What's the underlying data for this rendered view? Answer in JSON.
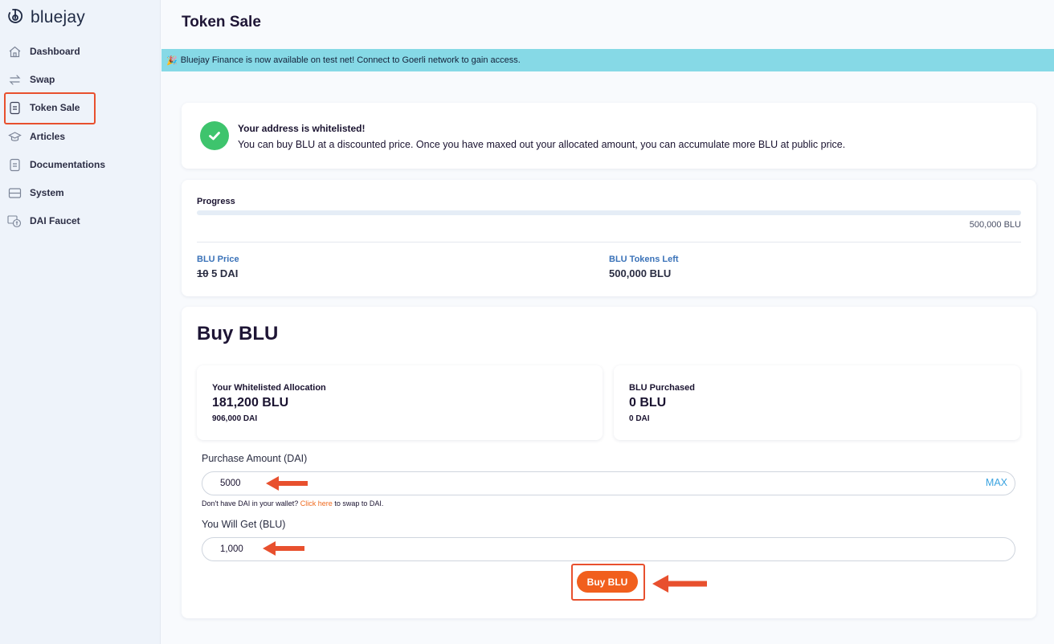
{
  "app": {
    "brand": "bluejay"
  },
  "sidebar": {
    "items": [
      {
        "label": "Dashboard",
        "icon": "home-icon"
      },
      {
        "label": "Swap",
        "icon": "swap-arrows-icon"
      },
      {
        "label": "Token Sale",
        "icon": "document-icon",
        "active": true
      },
      {
        "label": "Articles",
        "icon": "graduation-cap-icon"
      },
      {
        "label": "Documentations",
        "icon": "document-icon"
      },
      {
        "label": "System",
        "icon": "server-icon"
      },
      {
        "label": "DAI Faucet",
        "icon": "faucet-icon"
      }
    ]
  },
  "header": {
    "title": "Token Sale"
  },
  "banner": {
    "emoji": "🎉",
    "text": "Bluejay Finance is now available on test net! Connect to Goerli network to gain access."
  },
  "whitelist": {
    "title": "Your address is whitelisted!",
    "description": "You can buy BLU at a discounted price. Once you have maxed out your allocated amount, you can accumulate more BLU at public price."
  },
  "progress": {
    "label": "Progress",
    "fraction": 0,
    "total": "500,000 BLU",
    "price_label": "BLU Price",
    "price_old": "10",
    "price_new": "5 DAI",
    "tokens_left_label": "BLU Tokens Left",
    "tokens_left": "500,000 BLU"
  },
  "buy": {
    "title": "Buy BLU",
    "allocation_label": "Your Whitelisted Allocation",
    "allocation_blu": "181,200 BLU",
    "allocation_dai": "906,000 DAI",
    "purchased_label": "BLU Purchased",
    "purchased_blu": "0 BLU",
    "purchased_dai": "0 DAI",
    "purchase_amount_label": "Purchase Amount (DAI)",
    "purchase_amount_value": "5000",
    "max_label": "MAX",
    "hint_prefix": "Don't have DAI in your wallet?",
    "hint_link": "Click here",
    "hint_suffix": "to swap to DAI.",
    "you_get_label": "You Will Get (BLU)",
    "you_get_value": "1,000",
    "button_label": "Buy BLU"
  },
  "colors": {
    "accent": "#f15f1d",
    "highlight": "#e8502e",
    "banner": "#86d9e6",
    "success": "#3ec46d",
    "link": "#3a72b8"
  }
}
